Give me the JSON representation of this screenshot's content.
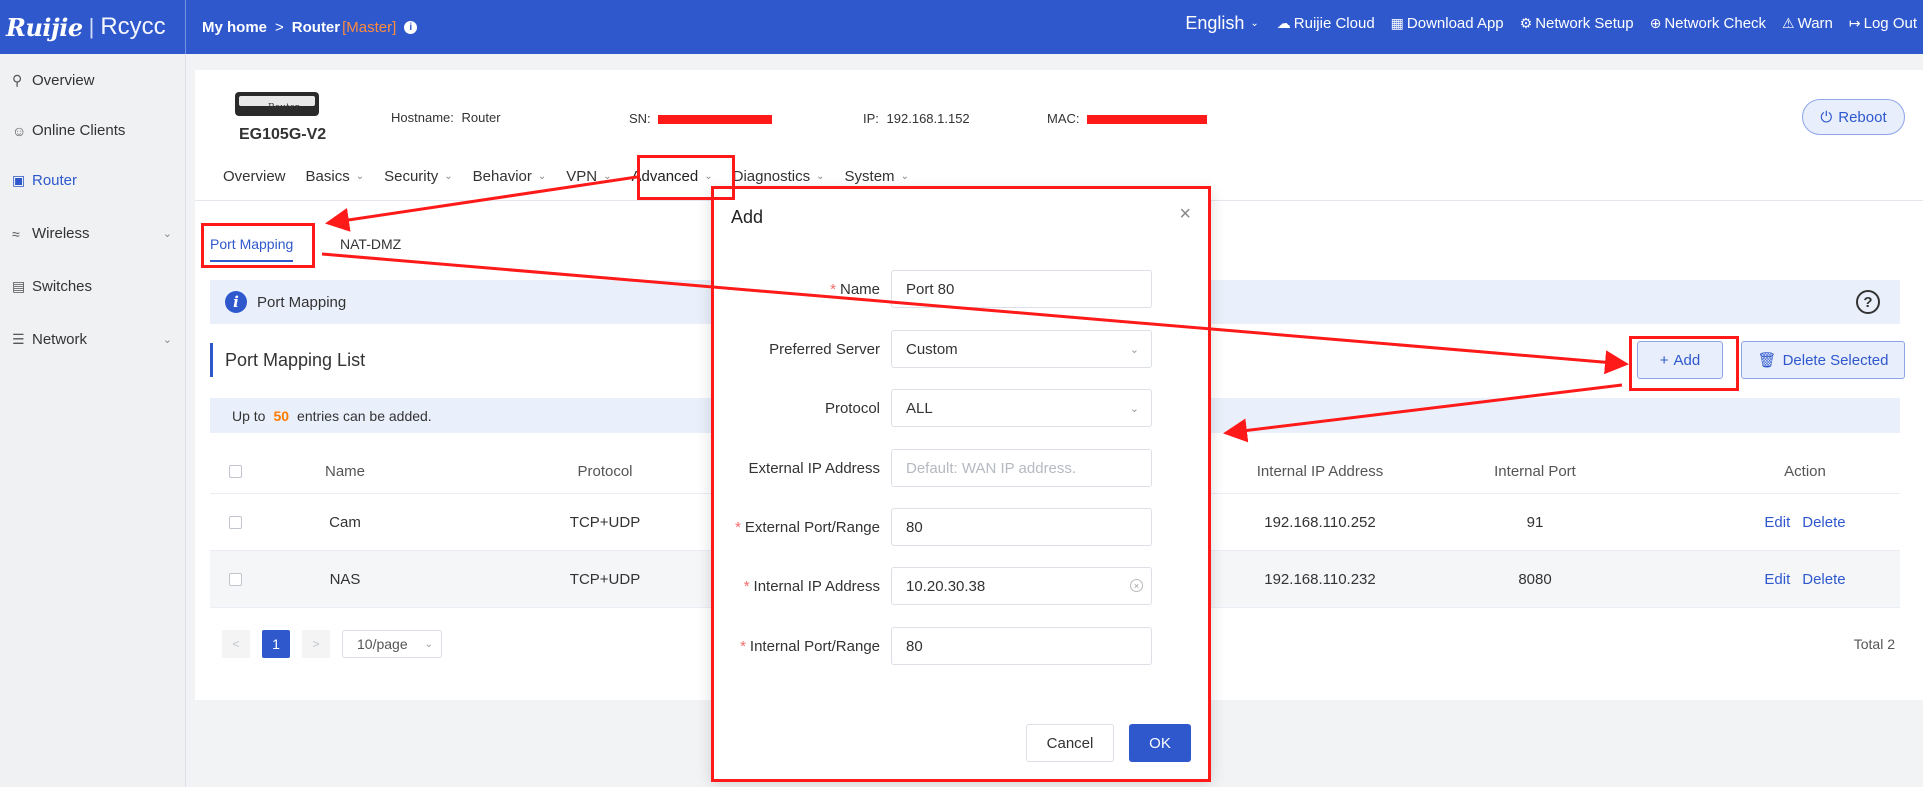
{
  "topbar": {
    "logo_brand": "Ruijie",
    "logo_sep": "|",
    "logo_product": "Rcycc",
    "crumb_home": "My home",
    "crumb_sep": ">",
    "crumb_device": "Router",
    "crumb_role": "[Master]",
    "nav": {
      "language": "English",
      "cloud": "Ruijie Cloud",
      "download": "Download App",
      "setup": "Network Setup",
      "check": "Network Check",
      "warn": "Warn",
      "logout": "Log Out"
    }
  },
  "sidebar": {
    "items": [
      {
        "label": "Overview"
      },
      {
        "label": "Online Clients"
      },
      {
        "label": "Router"
      },
      {
        "label": "Wireless"
      },
      {
        "label": "Switches"
      },
      {
        "label": "Network"
      }
    ]
  },
  "device": {
    "badge": "Router",
    "model": "EG105G-V2",
    "hostname_label": "Hostname:",
    "hostname": "Router",
    "sn_label": "SN:",
    "ip_label": "IP:",
    "ip": "192.168.1.152",
    "mac_label": "MAC:",
    "reboot": "Reboot"
  },
  "tabs": [
    {
      "label": "Overview"
    },
    {
      "label": "Basics"
    },
    {
      "label": "Security"
    },
    {
      "label": "Behavior"
    },
    {
      "label": "VPN"
    },
    {
      "label": "Advanced"
    },
    {
      "label": "Diagnostics"
    },
    {
      "label": "System"
    }
  ],
  "subtabs": {
    "port_mapping": "Port Mapping",
    "nat_dmz": "NAT-DMZ"
  },
  "info_bar": {
    "icon": "i",
    "text": "Port Mapping",
    "help": "?"
  },
  "list": {
    "title": "Port Mapping List",
    "add": "Add",
    "add_icon": "+",
    "delete_selected": "Delete Selected",
    "limit_prefix": "Up to",
    "limit_count": "50",
    "limit_suffix": "entries can be added."
  },
  "table": {
    "headers": {
      "name": "Name",
      "protocol": "Protocol",
      "internal_ip": "Internal IP Address",
      "internal_port": "Internal Port",
      "action": "Action"
    },
    "rows": [
      {
        "name": "Cam",
        "protocol": "TCP+UDP",
        "internal_ip": "192.168.110.252",
        "internal_port": "91",
        "edit": "Edit",
        "delete": "Delete"
      },
      {
        "name": "NAS",
        "protocol": "TCP+UDP",
        "internal_ip": "192.168.110.232",
        "internal_port": "8080",
        "edit": "Edit",
        "delete": "Delete"
      }
    ]
  },
  "pager": {
    "prev": "<",
    "page": "1",
    "next": ">",
    "page_size": "10/page",
    "total": "Total 2"
  },
  "modal": {
    "title": "Add",
    "close": "×",
    "fields": {
      "name_label": "Name",
      "name_value": "Port 80",
      "server_label": "Preferred Server",
      "server_value": "Custom",
      "protocol_label": "Protocol",
      "protocol_value": "ALL",
      "ext_ip_label": "External IP Address",
      "ext_ip_placeholder": "Default: WAN IP address.",
      "ext_port_label": "External Port/Range",
      "ext_port_value": "80",
      "int_ip_label": "Internal IP Address",
      "int_ip_value": "10.20.30.38",
      "int_port_label": "Internal Port/Range",
      "int_port_value": "80"
    },
    "required_mark": "*",
    "cancel": "Cancel",
    "ok": "OK"
  },
  "colors": {
    "brand": "#2f58cd",
    "annotation": "#ff1a1a",
    "required": "#f56c6c",
    "limit_count": "#ff7a00"
  }
}
